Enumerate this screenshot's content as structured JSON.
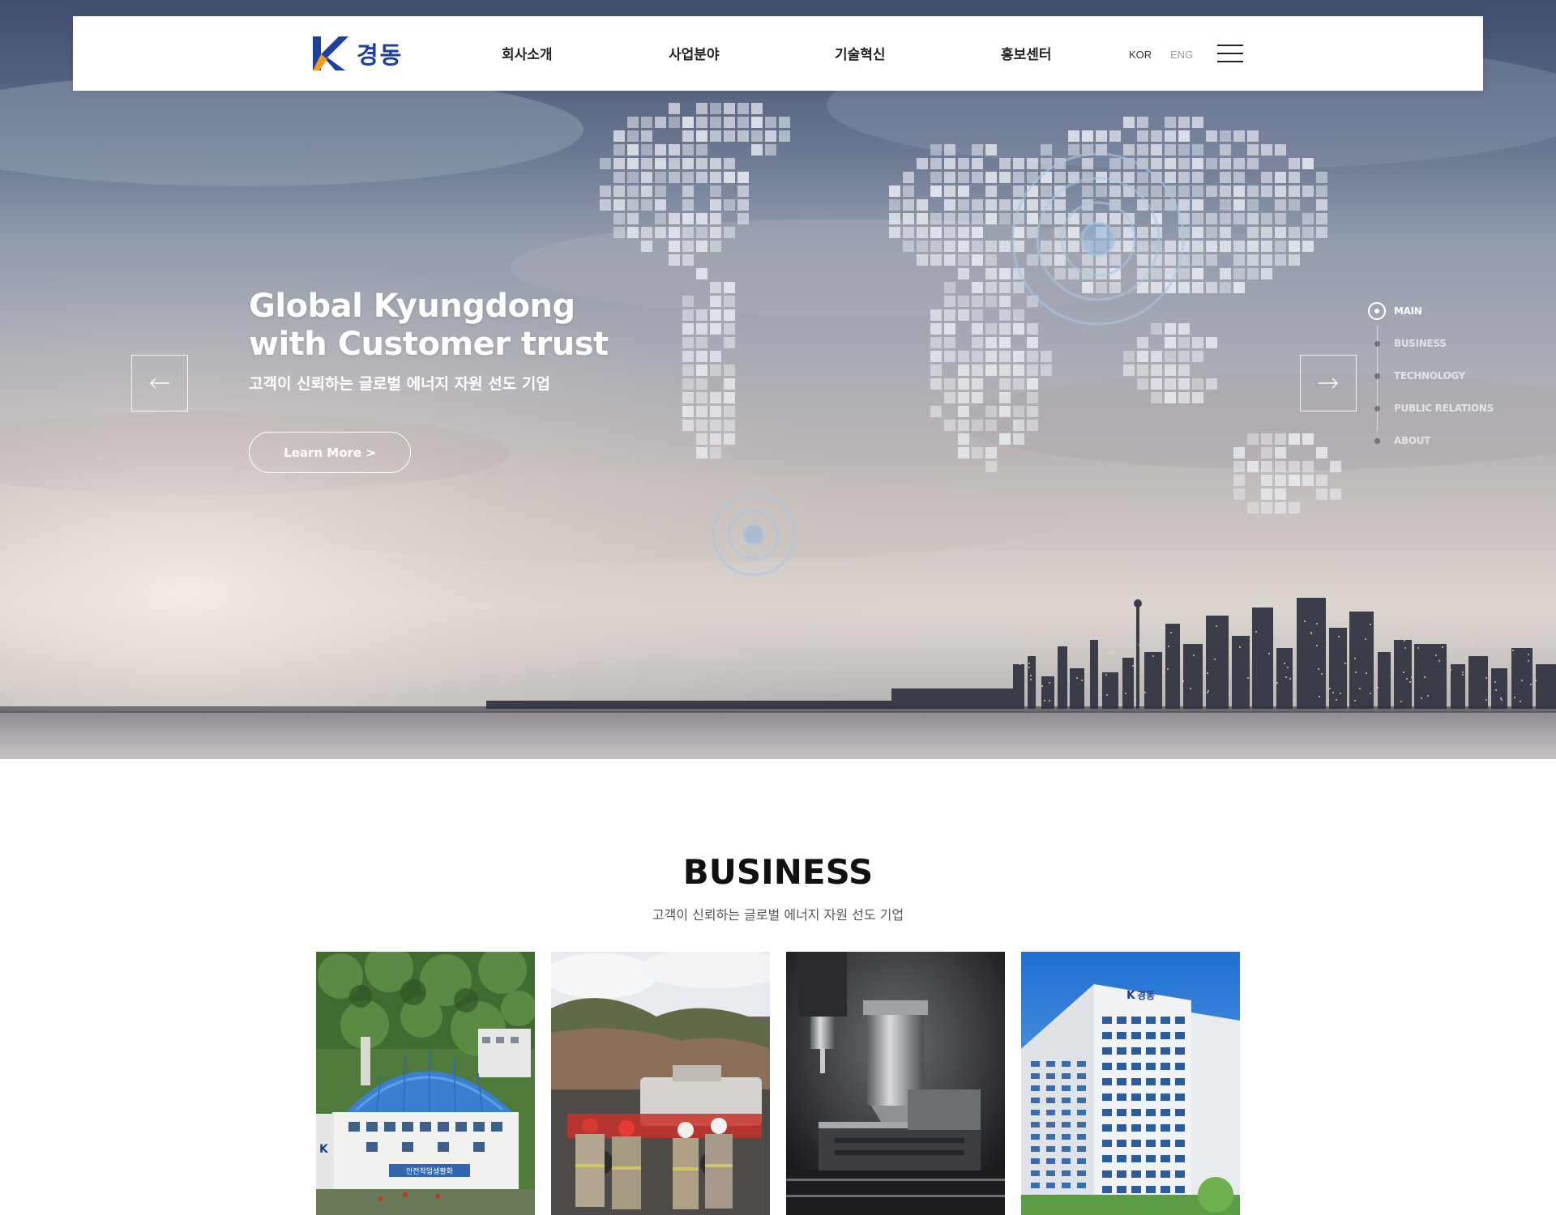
{
  "header": {
    "logo_text": "경동",
    "nav": [
      {
        "label": "회사소개"
      },
      {
        "label": "사업분야"
      },
      {
        "label": "기술혁신"
      },
      {
        "label": "홍보센터"
      }
    ],
    "lang_kor": "KOR",
    "lang_eng": "ENG"
  },
  "hero": {
    "title_line1": "Global Kyungdong",
    "title_line2": "with Customer trust",
    "subtitle": "고객이 신뢰하는 글로벌 에너지 자원 선도 기업",
    "cta_label": "Learn More >"
  },
  "side_nav": {
    "items": [
      {
        "label": "MAIN",
        "active": true
      },
      {
        "label": "BUSINESS",
        "active": false
      },
      {
        "label": "TECHNOLOGY",
        "active": false
      },
      {
        "label": "PUBLIC RELATIONS",
        "active": false
      },
      {
        "label": "ABOUT",
        "active": false
      }
    ]
  },
  "business": {
    "title": "BUSINESS",
    "subtitle": "고객이 신뢰하는 글로벌 에너지 자원 선도 기업",
    "cards": [
      {
        "icon": "mine-facility-photo",
        "sign_text": "안전작업생활화"
      },
      {
        "icon": "mining-workers-photo"
      },
      {
        "icon": "cnc-machining-photo"
      },
      {
        "icon": "office-building-photo",
        "sign_text": "경동"
      }
    ]
  },
  "colors": {
    "brand_blue": "#1d3f9c",
    "brand_orange": "#f39a1c",
    "hero_text": "#ffffff"
  }
}
